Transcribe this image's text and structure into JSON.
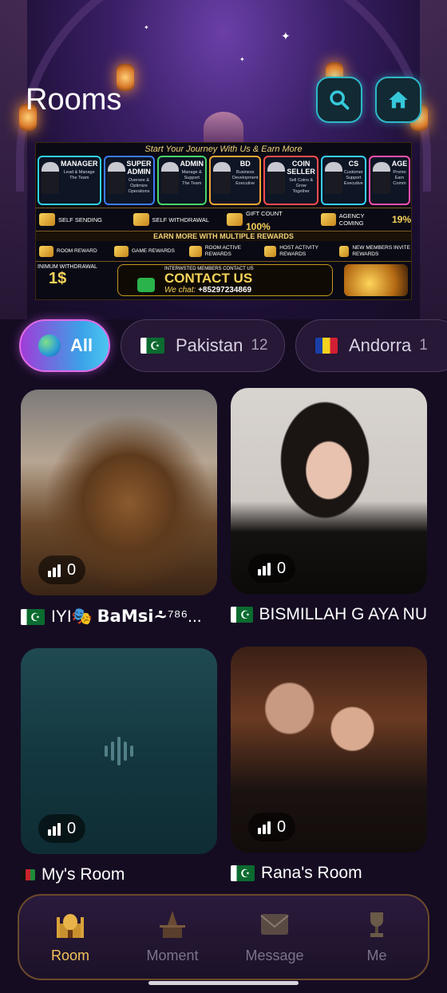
{
  "header": {
    "title": "Rooms"
  },
  "banner": {
    "tagline": "Start Your Journey With Us & Earn More",
    "roles": [
      {
        "title": "MANAGER",
        "desc": "Lead & Manage The Team"
      },
      {
        "title": "SUPER ADMIN",
        "desc": "Oversee & Optimize Operations"
      },
      {
        "title": "ADMIN",
        "desc": "Manage & Support The Team"
      },
      {
        "title": "BD",
        "desc": "Business Development Executive"
      },
      {
        "title": "COIN SELLER",
        "desc": "Sell Coins & Grow Together"
      },
      {
        "title": "CS",
        "desc": "Customer Support Executive"
      },
      {
        "title": "AGE",
        "desc": "Promo Earn Comm"
      }
    ],
    "perks": [
      {
        "label": "SELF SENDING"
      },
      {
        "label": "SELF WITHDRAWAL"
      },
      {
        "label": "GIFT COUNT",
        "value": "100%"
      },
      {
        "label": "AGENCY COMING",
        "value": "19%"
      }
    ],
    "earn_more": "EARN MORE WITH MULTIPLE REWARDS",
    "rewards": [
      "ROOM REWARD",
      "GAME REWARDS",
      "ROOM ACTIVE REWARDS",
      "HOST ACTIVITY REWARDS",
      "NEW MEMBERS INVITE REWARDS"
    ],
    "min_withdrawal_label": "INIMUM WITHDRAWAL",
    "min_withdrawal_value": "1$",
    "contact_note": "INTERWSTED MEMBERS CONTACT US",
    "contact_title": "CONTACT US",
    "wechat_label": "We chat:",
    "wechat_number": "+85297234869"
  },
  "filters": [
    {
      "label": "All",
      "active": true
    },
    {
      "label": "Pakistan",
      "count": "12",
      "flag": "pk"
    },
    {
      "label": "Andorra",
      "count": "1",
      "flag": "ad"
    }
  ],
  "rooms": [
    {
      "name": "IYI🎭 𝗕𝗮𝗠𝘀𝗶⩪⁷⁸⁶...",
      "online": "0",
      "flag": "pk"
    },
    {
      "name": "BISMILLAH G AYA NU",
      "online": "0",
      "flag": "pk"
    },
    {
      "name": "My's Room",
      "online": "0",
      "flag": "af"
    },
    {
      "name": "Rana's Room",
      "online": "0",
      "flag": "pk"
    }
  ],
  "nav": [
    {
      "label": "Room",
      "active": true,
      "icon": "palace-icon"
    },
    {
      "label": "Moment",
      "icon": "temple-icon"
    },
    {
      "label": "Message",
      "icon": "envelope-icon"
    },
    {
      "label": "Me",
      "icon": "trophy-icon"
    }
  ],
  "colors": {
    "accent_teal": "#2fb7c9",
    "accent_gold": "#f2c35a",
    "background": "#150c22"
  }
}
